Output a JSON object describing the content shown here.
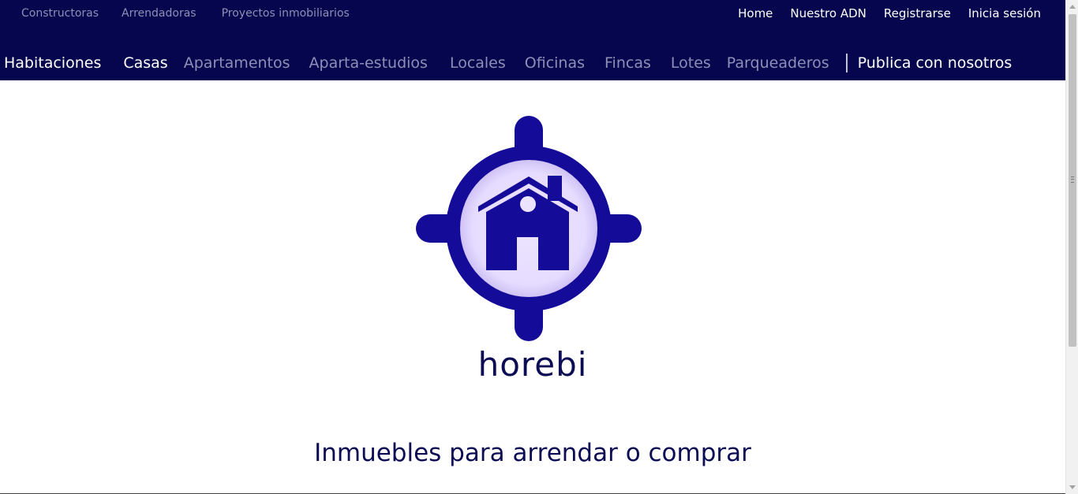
{
  "header": {
    "top_left_links": [
      {
        "label": "Constructoras"
      },
      {
        "label": "Arrendadoras"
      },
      {
        "label": "Proyectos inmobiliarios"
      }
    ],
    "top_right_links": [
      {
        "label": "Home"
      },
      {
        "label": "Nuestro ADN"
      },
      {
        "label": "Registrarse"
      },
      {
        "label": "Inicia sesión"
      }
    ],
    "categories": [
      {
        "label": "Habitaciones",
        "active": true
      },
      {
        "label": "Casas",
        "active": true
      },
      {
        "label": "Apartamentos",
        "active": false
      },
      {
        "label": "Aparta-estudios",
        "active": false
      },
      {
        "label": "Locales",
        "active": false
      },
      {
        "label": "Oficinas",
        "active": false
      },
      {
        "label": "Fincas",
        "active": false
      },
      {
        "label": "Lotes",
        "active": false
      },
      {
        "label": "Parqueaderos",
        "active": false
      }
    ],
    "publish_label": "Publica con nosotros"
  },
  "hero": {
    "logo_icon": "house-target-icon",
    "brand_name": "horebi",
    "tagline": "Inmuebles para arrendar o comprar"
  },
  "colors": {
    "header_bg": "#06064f",
    "logo_blue": "#140b99",
    "logo_inner": "#ece4ff",
    "text_dark": "#0c0c55",
    "muted_link": "#8c8fb6"
  }
}
